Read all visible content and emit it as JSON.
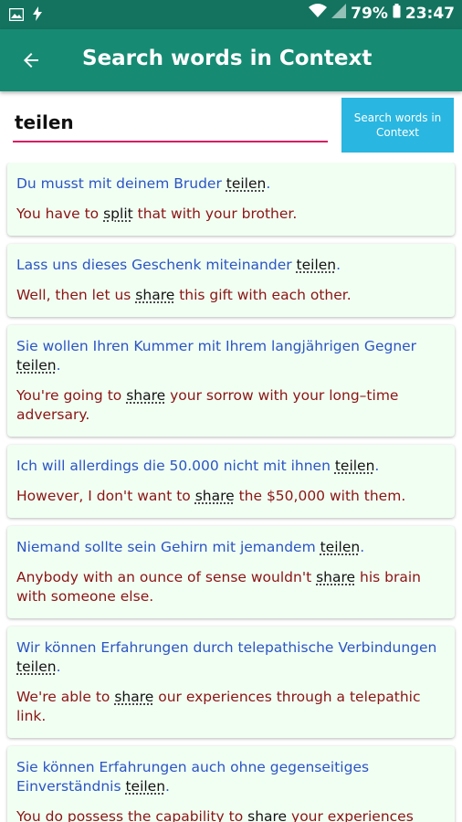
{
  "status_bar": {
    "battery": "79%",
    "time": "23:47"
  },
  "app_bar": {
    "title": "Search words in Context"
  },
  "search": {
    "value": "teilen",
    "button_label": "Search words in Context"
  },
  "results": [
    {
      "de": [
        "Du musst mit deinem Bruder ",
        "teilen",
        "."
      ],
      "en": [
        "You have to ",
        "split",
        " that with your brother."
      ]
    },
    {
      "de": [
        "Lass uns dieses Geschenk miteinander ",
        "teilen",
        "."
      ],
      "en": [
        "Well, then let us ",
        "share",
        " this gift with each other."
      ]
    },
    {
      "de": [
        "Sie wollen Ihren Kummer mit Ihrem langjährigen Gegner ",
        "teilen",
        "."
      ],
      "en": [
        "You're going to ",
        "share",
        " your sorrow with your long–time adversary."
      ]
    },
    {
      "de": [
        "Ich will allerdings die 50.000 nicht mit ihnen ",
        "teilen",
        "."
      ],
      "en": [
        "However, I don't want to ",
        "share",
        " the $50,000 with them."
      ]
    },
    {
      "de": [
        "Niemand sollte sein Gehirn mit jemandem ",
        "teilen",
        "."
      ],
      "en": [
        "Anybody with an ounce of sense wouldn't ",
        "share",
        " his brain with someone else."
      ]
    },
    {
      "de": [
        "Wir können Erfahrungen durch telepathische Verbindungen ",
        "teilen",
        "."
      ],
      "en": [
        "We're able to ",
        "share",
        " our experiences through a telepathic link."
      ]
    },
    {
      "de": [
        "Sie können Erfahrungen auch ohne gegenseitiges Einverständnis ",
        "teilen",
        "."
      ],
      "en": [
        "You do possess the capability to ",
        "share",
        " your experiences"
      ]
    }
  ]
}
